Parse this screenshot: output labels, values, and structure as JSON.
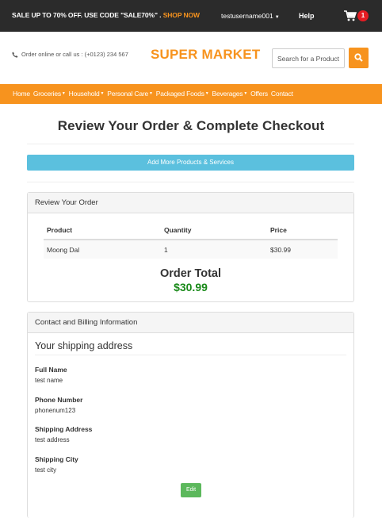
{
  "topbar": {
    "promo_text": "SALE UP TO 70% OFF. USE CODE \"SALE70%\" .",
    "shop_now": "SHOP NOW",
    "username": "testusername001",
    "help": "Help",
    "cart_count": "1"
  },
  "header": {
    "contact": "Order online or call us : (+0123) 234 567",
    "logo": "SUPER MARKET",
    "search_placeholder": "Search for a Product"
  },
  "nav": {
    "items": [
      {
        "label": "Home",
        "dropdown": false
      },
      {
        "label": "Groceries",
        "dropdown": true
      },
      {
        "label": "Household",
        "dropdown": true
      },
      {
        "label": "Personal Care",
        "dropdown": true
      },
      {
        "label": "Packaged Foods",
        "dropdown": true
      },
      {
        "label": "Beverages",
        "dropdown": true
      },
      {
        "label": "Offers",
        "dropdown": false
      },
      {
        "label": "Contact",
        "dropdown": false
      }
    ]
  },
  "page": {
    "title": "Review Your Order & Complete Checkout",
    "add_more_button": "Add More Products & Services"
  },
  "review": {
    "heading": "Review Your Order",
    "columns": [
      "Product",
      "Quantity",
      "Price"
    ],
    "rows": [
      {
        "product": "Moong Dal",
        "quantity": "1",
        "price": "$30.99"
      }
    ],
    "order_total_label": "Order Total",
    "order_total_value": "$30.99"
  },
  "billing": {
    "heading": "Contact and Billing Information",
    "shipping_heading": "Your shipping address",
    "fields": [
      {
        "label": "Full Name",
        "value": "test name"
      },
      {
        "label": "Phone Number",
        "value": "phonenum123"
      },
      {
        "label": "Shipping Address",
        "value": "test address"
      },
      {
        "label": "Shipping City",
        "value": "test city"
      }
    ],
    "edit_button": "Edit"
  },
  "colors": {
    "accent": "#f7931e",
    "topbar": "#2b2b2b",
    "info_button": "#5bc0de",
    "success": "#5cb85c",
    "total_green": "#1a8a1a",
    "badge": "#e51c23"
  }
}
